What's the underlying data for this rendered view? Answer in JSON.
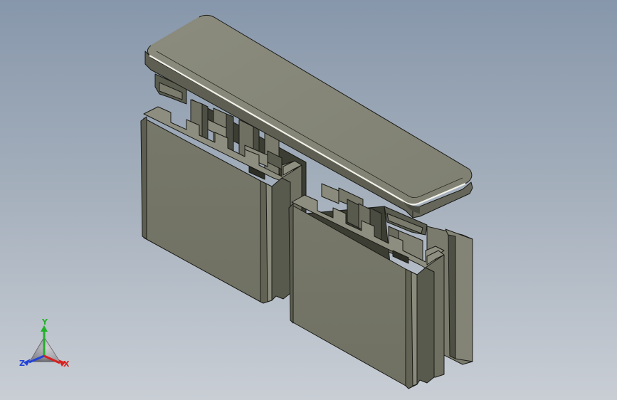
{
  "viewport": {
    "background_top": "#8797ab",
    "background_bottom": "#c9ced5",
    "model_colors": {
      "face_light": "#888a7b",
      "face_front": "#757667",
      "face_dark": "#4d4e43",
      "edge": "#1a1a16",
      "highlight": "#f2f2ea"
    }
  },
  "triad": {
    "x_label": "X",
    "y_label": "Y",
    "z_label": "Z",
    "x_color": "#d8201e",
    "y_color": "#23b02a",
    "z_color": "#2342d8"
  }
}
